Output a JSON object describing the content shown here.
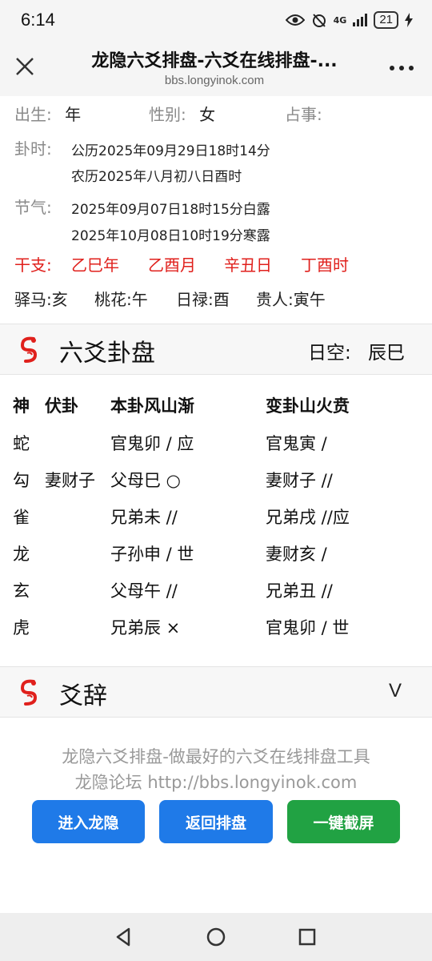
{
  "status_bar": {
    "time": "6:14",
    "network": "4G",
    "battery": "21"
  },
  "browser": {
    "title": "龙隐六爻排盘-六爻在线排盘-...",
    "url": "bbs.longyinok.com"
  },
  "info": {
    "birth_label": "出生:",
    "birth_value": "年",
    "gender_label": "性别:",
    "gender_value": "女",
    "matter_label": "占事:",
    "gua_time_label": "卦时:",
    "gua_time_solar": "公历2025年09月29日18时14分",
    "gua_time_lunar": "农历2025年八月初八日酉时",
    "jieqi_label": "节气:",
    "jieqi_1": "2025年09月07日18时15分白露",
    "jieqi_2": "2025年10月08日10时19分寒露",
    "ganzhi_label": "干支:",
    "ganzhi": [
      "乙巳年",
      "乙酉月",
      "辛丑日",
      "丁酉时"
    ],
    "shensha": [
      "驿马:亥",
      "桃花:午",
      "日禄:酉",
      "贵人:寅午"
    ]
  },
  "pan_section": {
    "title": "六爻卦盘",
    "kong_label": "日空:",
    "kong_value": "辰巳"
  },
  "table": {
    "headers": {
      "shen": "神",
      "fu": "伏卦",
      "ben": "本卦风山渐",
      "bian": "变卦山火贲"
    },
    "rows": [
      {
        "shen": "蛇",
        "fu": "",
        "ben": "官鬼卯 / 应",
        "bian": "官鬼寅 /"
      },
      {
        "shen": "勾",
        "fu": "妻财子",
        "ben": "父母巳 ○",
        "bian": "妻财子 //"
      },
      {
        "shen": "雀",
        "fu": "",
        "ben": "兄弟未 //",
        "bian": "兄弟戌 //应"
      },
      {
        "shen": "龙",
        "fu": "",
        "ben": "子孙申 / 世",
        "bian": "妻财亥 /"
      },
      {
        "shen": "玄",
        "fu": "",
        "ben": "父母午 //",
        "bian": "兄弟丑 //"
      },
      {
        "shen": "虎",
        "fu": "",
        "ben": "兄弟辰 ×",
        "bian": "官鬼卯 / 世"
      }
    ]
  },
  "yaoci_section": {
    "title": "爻辞",
    "toggle": "V"
  },
  "footer": {
    "line1": "龙隐六爻排盘-做最好的六爻在线排盘工具",
    "line2": "龙隐论坛 http://bbs.longyinok.com",
    "buttons": {
      "enter": "进入龙隐",
      "back": "返回排盘",
      "screenshot": "一键截屏"
    }
  }
}
